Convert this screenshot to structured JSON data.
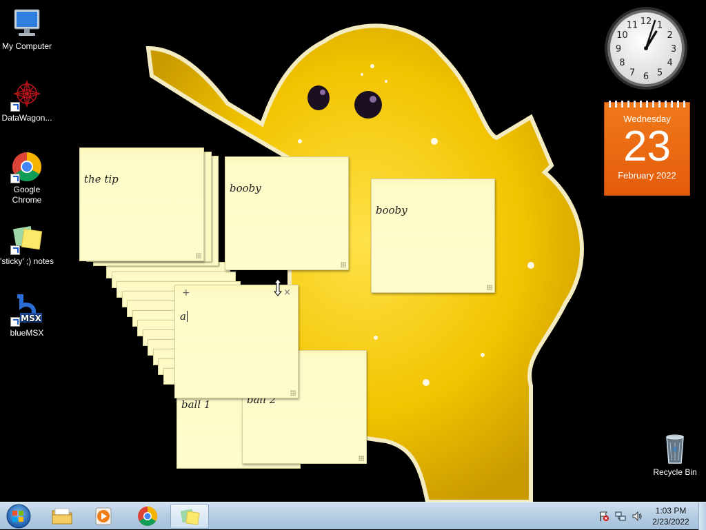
{
  "desktop": {
    "icons": [
      {
        "label": "My Computer",
        "icon": "computer-icon"
      },
      {
        "label": "DataWagon...",
        "icon": "datawagon-icon"
      },
      {
        "label": "Google Chrome",
        "icon": "chrome-icon"
      },
      {
        "label": "'sticky' ;) notes",
        "icon": "sticky-notes-icon"
      },
      {
        "label": "blueMSX",
        "icon": "bluemsx-icon"
      }
    ],
    "recycle_bin": {
      "label": "Recycle Bin",
      "icon": "recycle-bin-icon"
    }
  },
  "gadgets": {
    "clock": {
      "hour": 1,
      "minute": 3,
      "numerals": [
        "12",
        "1",
        "2",
        "3",
        "4",
        "5",
        "6",
        "7",
        "8",
        "9",
        "10",
        "11"
      ]
    },
    "calendar": {
      "weekday": "Wednesday",
      "day": "23",
      "month_year": "February 2022",
      "color": "#e8630f"
    }
  },
  "notes": [
    {
      "text": "the tip"
    },
    {
      "text": "booby"
    },
    {
      "text": "booby"
    },
    {
      "text": "a"
    },
    {
      "text": "ball 1"
    },
    {
      "text": "ball 2"
    }
  ],
  "active_note": {
    "add_glyph": "+",
    "close_glyph": "×"
  },
  "taskbar": {
    "start": {
      "icon": "windows-orb-icon"
    },
    "pinned": [
      {
        "name": "explorer",
        "icon": "folder-icon"
      },
      {
        "name": "media-player",
        "icon": "media-player-icon"
      },
      {
        "name": "chrome",
        "icon": "chrome-icon"
      },
      {
        "name": "sticky-notes",
        "icon": "sticky-notes-icon",
        "active": true
      }
    ],
    "tray": {
      "icons": [
        "action-center-flag-icon",
        "network-icon",
        "volume-icon"
      ],
      "time": "1:03 PM",
      "date": "2/23/2022"
    }
  },
  "colors": {
    "note_yellow": "#fefccd",
    "wallpaper_yellow": "#f2c400",
    "taskbar": "#b5cde3"
  }
}
